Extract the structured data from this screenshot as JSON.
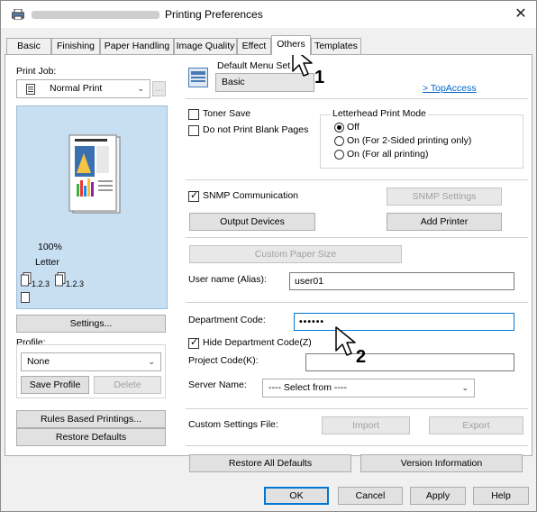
{
  "window": {
    "title": "Printing Preferences",
    "close_glyph": "✕"
  },
  "tabs": [
    "Basic",
    "Finishing",
    "Paper Handling",
    "Image Quality",
    "Effect",
    "Others",
    "Templates"
  ],
  "active_tab": "Others",
  "left": {
    "print_job_label": "Print Job:",
    "print_job_value": "Normal Print",
    "zoom_text": "100%",
    "paper_text": "Letter",
    "collate_1": "1.2.3",
    "collate_2": "1.2.3",
    "settings_button": "Settings...",
    "profile_label": "Profile:",
    "profile_value": "None",
    "save_profile_button": "Save Profile",
    "delete_button": "Delete",
    "rules_button": "Rules Based Printings...",
    "restore_defaults_button": "Restore Defaults"
  },
  "right": {
    "default_menu_label": "Default Menu Set",
    "default_menu_value": "Basic",
    "top_access_link": "> TopAccess",
    "toner_save_label": "Toner Save",
    "no_blank_pages_label": "Do not Print Blank Pages",
    "letterhead_legend": "Letterhead Print Mode",
    "letterhead_options": [
      "Off",
      "On (For 2-Sided printing only)",
      "On (For all printing)"
    ],
    "letterhead_selected": 0,
    "snmp_label": "SNMP Communication",
    "snmp_settings_button": "SNMP Settings",
    "output_devices_button": "Output Devices",
    "add_printer_button": "Add Printer",
    "custom_paper_size_button": "Custom Paper Size",
    "user_name_label": "User name (Alias):",
    "user_name_value": "user01",
    "department_code_label": "Department Code:",
    "department_code_value": "••••••",
    "hide_dept_label": "Hide Department Code(Z)",
    "project_code_label": "Project Code(K):",
    "project_code_value": "",
    "server_name_label": "Server Name:",
    "server_name_value": "---- Select from ----",
    "custom_settings_label": "Custom Settings File:",
    "import_button": "Import",
    "export_button": "Export",
    "restore_all_button": "Restore All Defaults",
    "version_button": "Version Information"
  },
  "footer": {
    "ok": "OK",
    "cancel": "Cancel",
    "apply": "Apply",
    "help": "Help"
  },
  "annotations": {
    "callout_1": "1",
    "callout_2": "2"
  },
  "colors": {
    "accent": "#0078d7",
    "preview_bg": "#c8dff2",
    "link": "#0066cc"
  }
}
